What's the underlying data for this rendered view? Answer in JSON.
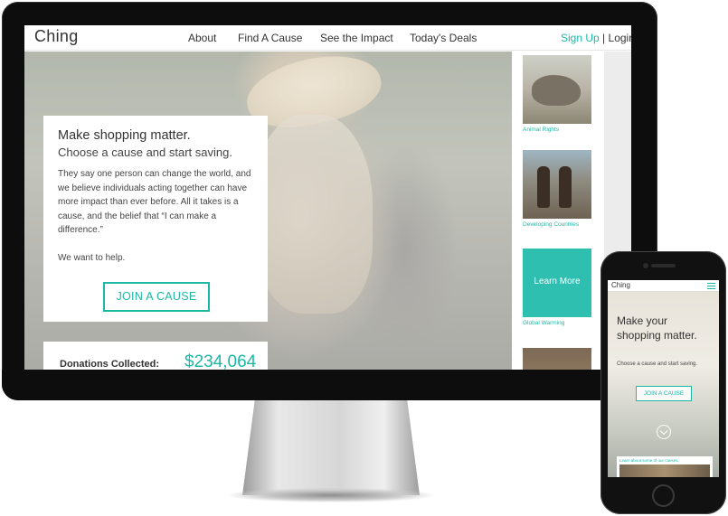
{
  "brand": {
    "name": "Ching",
    "accent": "#1cb8a6"
  },
  "desktop": {
    "nav": {
      "links": [
        "About",
        "Find A Cause",
        "See the Impact",
        "Today's Deals"
      ],
      "signup": "Sign Up",
      "separator": "|",
      "login": "Login"
    },
    "intro": {
      "headline": "Make shopping matter.",
      "subheadline": "Choose a cause and start saving.",
      "body": "They say one person can change the world, and we believe individuals acting together can have more impact than ever before.  All it takes is a cause, and the belief that “I can make a difference.”",
      "closing": "We want to help.",
      "cta": "JOIN A CAUSE"
    },
    "donations": {
      "label": "Donations Collected:",
      "value": "$234,064"
    },
    "causes": [
      {
        "label": "Animal Rights",
        "icon": "rhino-photo"
      },
      {
        "label": "Developing Countries",
        "icon": "children-photo"
      },
      {
        "label": "Global Warming",
        "overlay": "Learn More",
        "icon": "glacier-photo"
      }
    ]
  },
  "mobile": {
    "headline": "Make your shopping matter.",
    "subheadline": "Choose a cause and start saving.",
    "cta": "JOIN A CAUSE",
    "footer_text": "Learn about some of our causes."
  },
  "hardware": {
    "apple_logo": ""
  }
}
